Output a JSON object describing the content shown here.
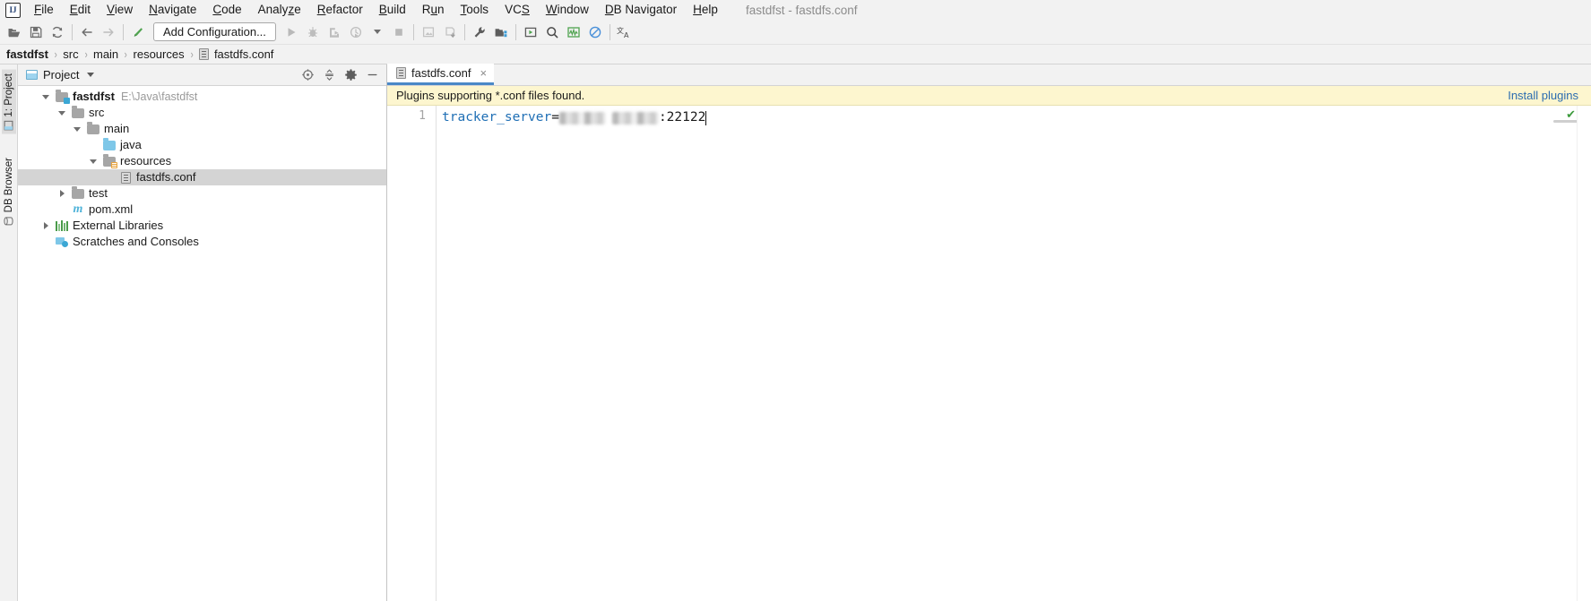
{
  "window": {
    "title": "fastdfst - fastdfs.conf",
    "app_icon": "intellij-idea-logo"
  },
  "menubar": {
    "items": [
      {
        "label": "File",
        "mnemonic": "F"
      },
      {
        "label": "Edit",
        "mnemonic": "E"
      },
      {
        "label": "View",
        "mnemonic": "V"
      },
      {
        "label": "Navigate",
        "mnemonic": "N"
      },
      {
        "label": "Code",
        "mnemonic": "C"
      },
      {
        "label": "Analyze",
        "mnemonic": "z"
      },
      {
        "label": "Refactor",
        "mnemonic": "R"
      },
      {
        "label": "Build",
        "mnemonic": "B"
      },
      {
        "label": "Run",
        "mnemonic": "u"
      },
      {
        "label": "Tools",
        "mnemonic": "T"
      },
      {
        "label": "VCS",
        "mnemonic": "S"
      },
      {
        "label": "Window",
        "mnemonic": "W"
      },
      {
        "label": "DB Navigator",
        "mnemonic": "D"
      },
      {
        "label": "Help",
        "mnemonic": "H"
      }
    ]
  },
  "toolbar": {
    "buttons": [
      {
        "name": "open-project-icon",
        "tooltip": "Open"
      },
      {
        "name": "save-all-icon",
        "tooltip": "Save All"
      },
      {
        "name": "sync-refresh-icon",
        "tooltip": "Synchronize"
      },
      {
        "name": "navigate-back-icon",
        "tooltip": "Back"
      },
      {
        "name": "navigate-forward-icon",
        "tooltip": "Forward"
      },
      {
        "name": "build-hammer-icon",
        "tooltip": "Build Project"
      }
    ],
    "run_configuration": "Add Configuration...",
    "run_buttons": [
      {
        "name": "run-icon",
        "tooltip": "Run"
      },
      {
        "name": "debug-icon",
        "tooltip": "Debug"
      },
      {
        "name": "run-with-coverage-icon",
        "tooltip": "Run with Coverage"
      },
      {
        "name": "profile-icon",
        "tooltip": "Profile"
      },
      {
        "name": "stop-icon",
        "tooltip": "Stop"
      }
    ],
    "right_buttons": [
      {
        "name": "update-project-icon",
        "tooltip": "Update Project"
      },
      {
        "name": "commit-icon",
        "tooltip": "Commit"
      },
      {
        "name": "settings-wrench-icon",
        "tooltip": "Settings"
      },
      {
        "name": "project-structure-icon",
        "tooltip": "Project Structure"
      },
      {
        "name": "select-in-icon",
        "tooltip": "Select In"
      },
      {
        "name": "search-everywhere-icon",
        "tooltip": "Search Everywhere"
      },
      {
        "name": "db-navigator-icon",
        "tooltip": "DB Navigator"
      },
      {
        "name": "disable-icon",
        "tooltip": "Disable"
      },
      {
        "name": "translate-icon",
        "tooltip": "Translate"
      }
    ]
  },
  "breadcrumb": {
    "segments": [
      "fastdfst",
      "src",
      "main",
      "resources",
      "fastdfs.conf"
    ],
    "separator": "›"
  },
  "stripes": {
    "left": [
      {
        "label": "1: Project",
        "icon": "project-tool-icon",
        "active": true
      },
      {
        "label": "DB Browser",
        "icon": "db-browser-icon",
        "active": false
      }
    ]
  },
  "project_panel": {
    "title": "Project",
    "tools": [
      {
        "name": "scroll-from-source-icon",
        "tooltip": "Select Opened File"
      },
      {
        "name": "collapse-all-icon",
        "tooltip": "Collapse All"
      },
      {
        "name": "settings-gear-icon",
        "tooltip": "Options"
      },
      {
        "name": "hide-panel-icon",
        "tooltip": "Hide"
      }
    ],
    "tree": [
      {
        "label": "fastdfst",
        "sublabel": "E:\\Java\\fastdfst",
        "icon": "module-folder-icon",
        "depth": 0,
        "expanded": true,
        "bold": true,
        "selected": false
      },
      {
        "label": "src",
        "sublabel": "",
        "icon": "folder-icon",
        "depth": 1,
        "expanded": true,
        "bold": false,
        "selected": false
      },
      {
        "label": "main",
        "sublabel": "",
        "icon": "folder-icon",
        "depth": 2,
        "expanded": true,
        "bold": false,
        "selected": false
      },
      {
        "label": "java",
        "sublabel": "",
        "icon": "source-folder-icon",
        "depth": 3,
        "expanded": null,
        "bold": false,
        "selected": false
      },
      {
        "label": "resources",
        "sublabel": "",
        "icon": "resources-folder-icon",
        "depth": 3,
        "expanded": true,
        "bold": false,
        "selected": false
      },
      {
        "label": "fastdfs.conf",
        "sublabel": "",
        "icon": "conf-file-icon",
        "depth": 4,
        "expanded": null,
        "bold": false,
        "selected": true
      },
      {
        "label": "test",
        "sublabel": "",
        "icon": "folder-icon",
        "depth": 2,
        "expanded": false,
        "bold": false,
        "selected": false
      },
      {
        "label": "pom.xml",
        "sublabel": "",
        "icon": "maven-file-icon",
        "depth": 2,
        "expanded": null,
        "bold": false,
        "selected": false
      },
      {
        "label": "External Libraries",
        "sublabel": "",
        "icon": "libraries-icon",
        "depth": 0,
        "expanded": false,
        "bold": false,
        "selected": false
      },
      {
        "label": "Scratches and Consoles",
        "sublabel": "",
        "icon": "scratches-icon",
        "depth": 0,
        "expanded": null,
        "bold": false,
        "selected": false
      }
    ]
  },
  "editor": {
    "tabs": [
      {
        "label": "fastdfs.conf",
        "icon": "conf-file-icon",
        "active": true,
        "close": "×"
      }
    ],
    "notification": {
      "message": "Plugins supporting *.conf files found.",
      "action_label": "Install plugins",
      "background": "#fdf6cf",
      "link_color": "#2b6cb0"
    },
    "gutter": {
      "line_numbers": [
        "1"
      ]
    },
    "content": {
      "lines": [
        {
          "number": "1",
          "key": "tracker_server",
          "equals": "=",
          "redacted_value": "",
          "redacted_segments": [
            52,
            52
          ],
          "port": ":22122",
          "caret_after": true
        }
      ]
    },
    "inspection": {
      "status_icon": "checkmark-icon",
      "status_glyph": "✔",
      "color": "#3c9a3c"
    }
  }
}
